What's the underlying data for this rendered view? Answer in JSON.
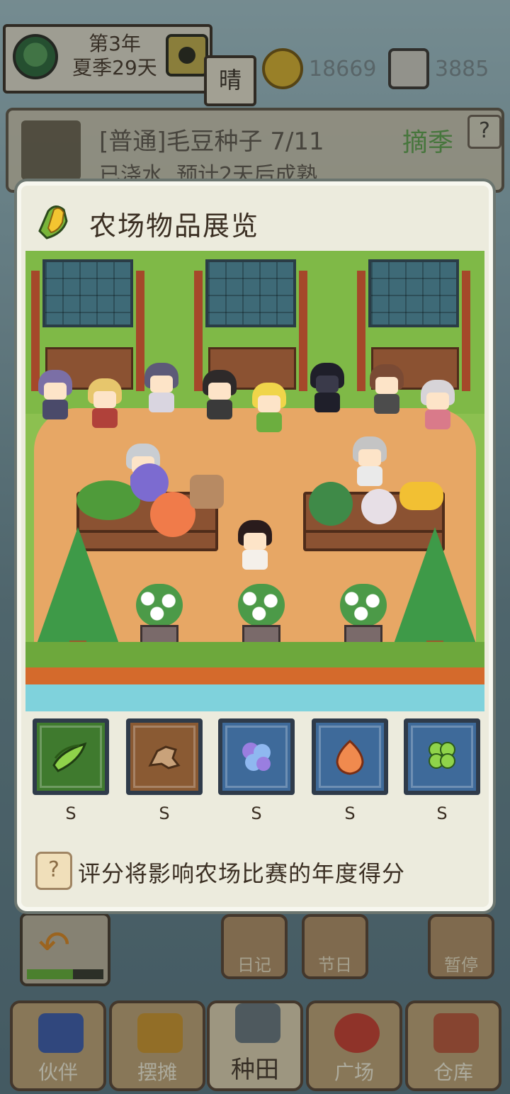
{
  "hud": {
    "year": "第3年",
    "season_day": "夏季29天",
    "weather": "晴",
    "gold": "18669",
    "gems": "3885"
  },
  "crop_panel": {
    "name": "[普通]毛豆种子  7/11",
    "status": "已浇水, 预计2天后成熟",
    "action": "摘季",
    "help": "?"
  },
  "side_buttons": {
    "diary": "日记",
    "festival": "节日",
    "pause": "暂停"
  },
  "undo": {
    "progress": 0.6
  },
  "bottom_nav": [
    {
      "label": "伙伴",
      "icon": "partners-icon"
    },
    {
      "label": "摆摊",
      "icon": "stall-icon"
    },
    {
      "label": "种田",
      "icon": "watering-can-icon"
    },
    {
      "label": "广场",
      "icon": "flower-icon"
    },
    {
      "label": "仓库",
      "icon": "warehouse-icon"
    }
  ],
  "modal": {
    "title": "农场物品展览",
    "items": [
      {
        "name": "edamame",
        "grade": "S",
        "frame_color": "#3f7a2e",
        "icon": "edamame-icon"
      },
      {
        "name": "ginger",
        "grade": "S",
        "frame_color": "#8a5a33",
        "icon": "ginger-icon"
      },
      {
        "name": "blue-flower",
        "grade": "S",
        "frame_color": "#3e6a9a",
        "icon": "blue-flower-icon"
      },
      {
        "name": "onion",
        "grade": "S",
        "frame_color": "#3e6a9a",
        "icon": "onion-icon"
      },
      {
        "name": "clover",
        "grade": "S",
        "frame_color": "#3e6a9a",
        "icon": "clover-icon"
      }
    ],
    "tip_icon": "?",
    "tip": "评分将影响农场比赛的年度得分"
  },
  "colors": {
    "panel_bg": "#ecebdd",
    "grass": "#8cc050",
    "ground": "#e7a765"
  }
}
